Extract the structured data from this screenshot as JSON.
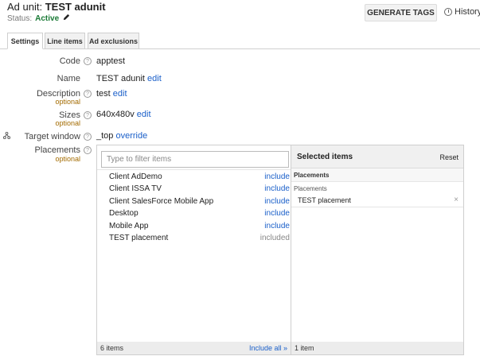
{
  "header": {
    "title_prefix": "Ad unit:",
    "title_name": "TEST adunit",
    "status_label": "Status:",
    "status_value": "Active",
    "generate_button": "GENERATE TAGS",
    "history_label": "History"
  },
  "tabs": [
    {
      "label": "Settings",
      "active": true
    },
    {
      "label": "Line items",
      "active": false
    },
    {
      "label": "Ad exclusions",
      "active": false
    }
  ],
  "help_glyph": "?",
  "optional_text": "optional",
  "fields": {
    "code": {
      "label": "Code",
      "value": "apptest"
    },
    "name": {
      "label": "Name",
      "value": "TEST adunit",
      "action": "edit"
    },
    "description": {
      "label": "Description",
      "value": "test",
      "action": "edit"
    },
    "sizes": {
      "label": "Sizes",
      "value": "640x480v",
      "action": "edit"
    },
    "target_window": {
      "label": "Target window",
      "value": "_top",
      "action": "override"
    },
    "placements": {
      "label": "Placements"
    }
  },
  "picker": {
    "filter_placeholder": "Type to filter items",
    "items": [
      {
        "name": "Client AdDemo",
        "action": "include"
      },
      {
        "name": "Client ISSA TV",
        "action": "include"
      },
      {
        "name": "Client SalesForce Mobile App",
        "action": "include"
      },
      {
        "name": "Desktop",
        "action": "include"
      },
      {
        "name": "Mobile App",
        "action": "include"
      },
      {
        "name": "TEST placement",
        "action": "included"
      }
    ],
    "left_count": "6 items",
    "include_all": "Include all »",
    "selected_title": "Selected items",
    "reset": "Reset",
    "group_header": "Placements",
    "group_label": "Placements",
    "selected": [
      {
        "name": "TEST placement"
      }
    ],
    "right_count": "1 item",
    "remove_glyph": "×"
  },
  "colors": {
    "active_status": "#1a7a36",
    "link": "#1a5fc9",
    "optional": "#a36b00"
  }
}
